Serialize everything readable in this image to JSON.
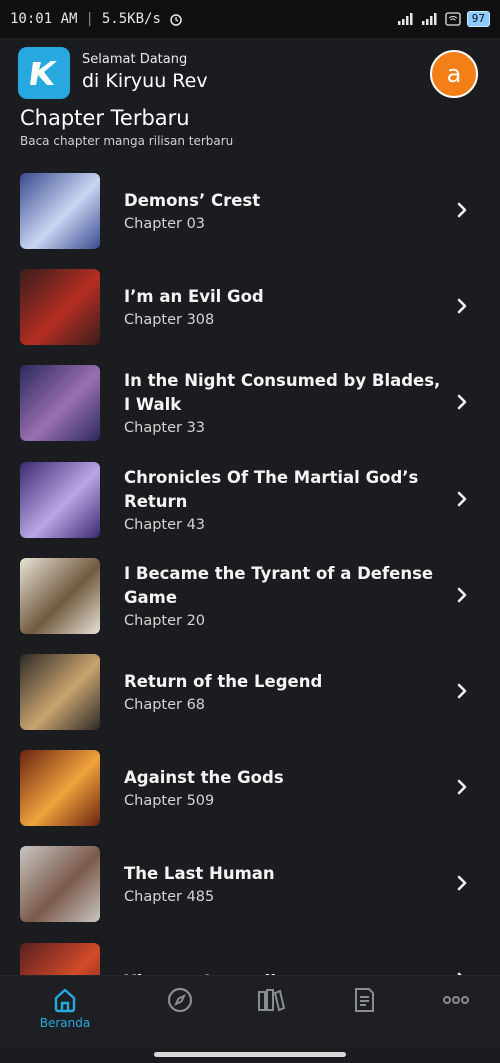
{
  "status_bar": {
    "time": "10:01 AM",
    "network_speed": "5.5KB/s",
    "battery": "97"
  },
  "header": {
    "welcome": "Selamat Datang",
    "app_name": "di Kiryuu Rev",
    "avatar_letter": "a",
    "logo_icon": "kiryuu-logo-icon"
  },
  "section": {
    "title": "Chapter Terbaru",
    "subtitle": "Baca chapter manga rilisan terbaru"
  },
  "items": [
    {
      "title": "Demons’ Crest",
      "chapter": "Chapter  03",
      "thumb_colors": [
        "#3a4b8f",
        "#c9d6f2"
      ]
    },
    {
      "title": "I’m an Evil God",
      "chapter": "Chapter  308",
      "thumb_colors": [
        "#3a1d1d",
        "#b52e22"
      ]
    },
    {
      "title": "In the Night Consumed by Blades, I Walk",
      "chapter": "Chapter  33",
      "thumb_colors": [
        "#2b2a5c",
        "#9a6fb0"
      ]
    },
    {
      "title": "Chronicles Of The Martial God’s Return",
      "chapter": "Chapter  43",
      "thumb_colors": [
        "#3b2a6e",
        "#b9a6e6"
      ]
    },
    {
      "title": "I Became the Tyrant of a Defense Game",
      "chapter": "Chapter  20",
      "thumb_colors": [
        "#e9e3d6",
        "#6f5a3f"
      ]
    },
    {
      "title": "Return of the Legend",
      "chapter": "Chapter  68",
      "thumb_colors": [
        "#2e2a26",
        "#c9a46f"
      ]
    },
    {
      "title": "Against the Gods",
      "chapter": "Chapter  509",
      "thumb_colors": [
        "#6b2412",
        "#f0a23c"
      ]
    },
    {
      "title": "The Last Human",
      "chapter": "Chapter  485",
      "thumb_colors": [
        "#c9c6c2",
        "#7a5a4a"
      ]
    },
    {
      "title": "Xianzun Luowuji",
      "chapter": "",
      "thumb_colors": [
        "#5a1f1f",
        "#d24a2a"
      ]
    }
  ],
  "bottom_nav": {
    "tabs": [
      {
        "label": "Beranda",
        "icon": "home-icon",
        "active": true
      },
      {
        "label": "",
        "icon": "compass-icon",
        "active": false
      },
      {
        "label": "",
        "icon": "library-icon",
        "active": false
      },
      {
        "label": "",
        "icon": "history-icon",
        "active": false
      },
      {
        "label": "",
        "icon": "more-icon",
        "active": false
      }
    ]
  },
  "colors": {
    "accent": "#27a9df",
    "avatar": "#f57f17",
    "background": "#1b1c20"
  }
}
